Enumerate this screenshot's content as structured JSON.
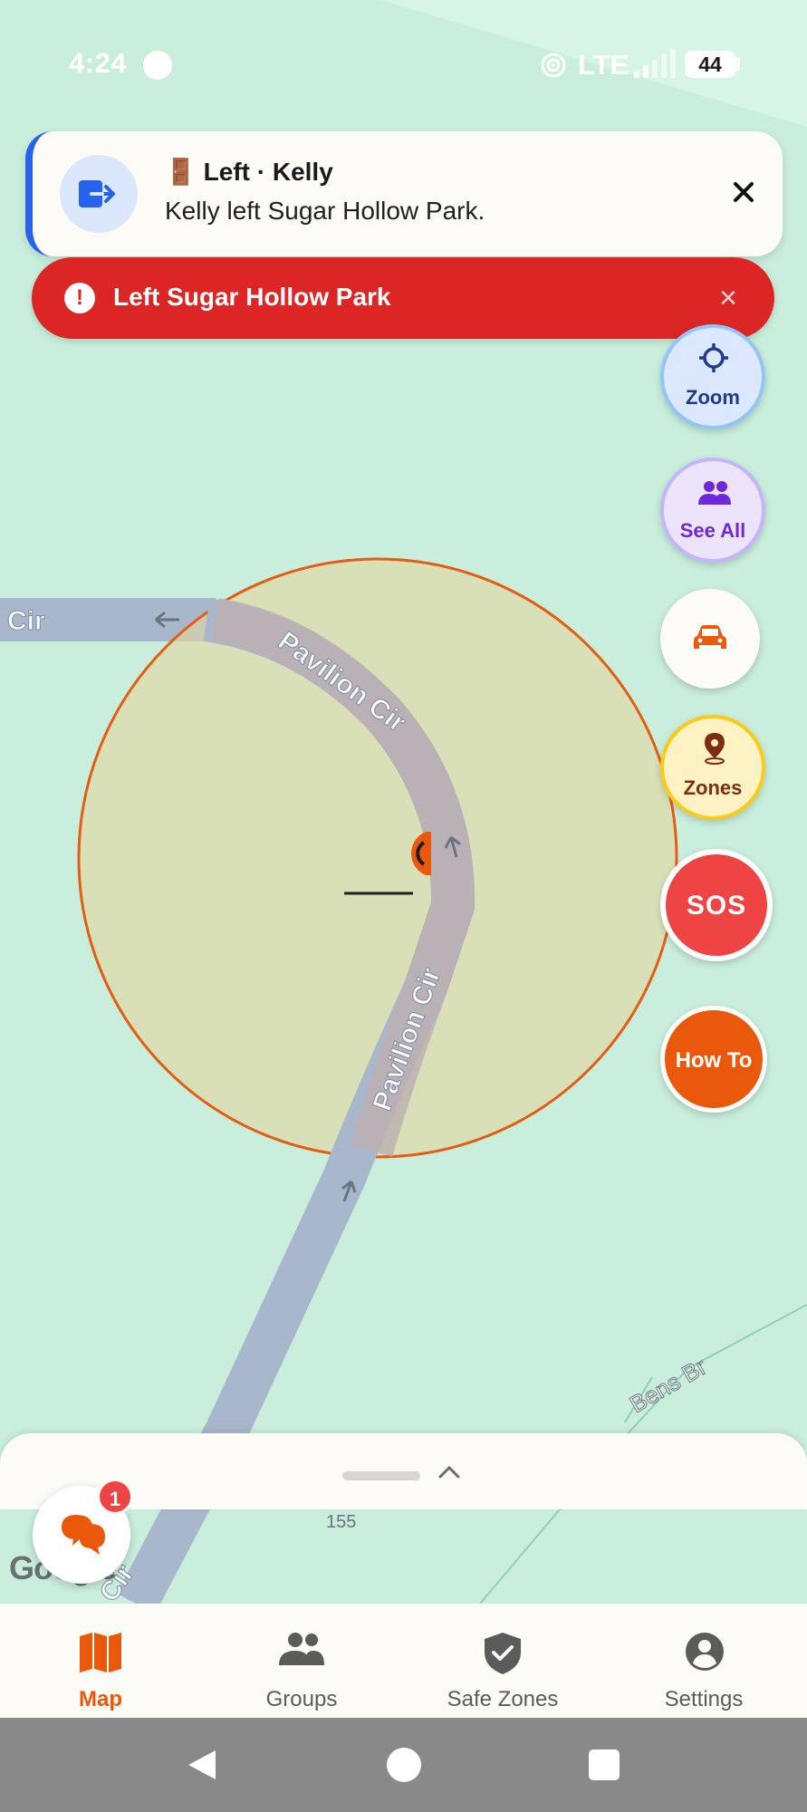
{
  "status_bar": {
    "time": "4:24",
    "network": "LTE",
    "battery": "44"
  },
  "map": {
    "street_labels": [
      "Cir",
      "Pavilion Cir",
      "Pavilion Cir",
      "Bens Br",
      "155",
      "Cir"
    ],
    "provider": "Google",
    "zone_color": "#e35d14"
  },
  "notification": {
    "icon": "exit-door-icon",
    "emoji": "🚪",
    "title": "Left · Kelly",
    "body": "Kelly left Sugar Hollow Park.",
    "accent": "#2563eb"
  },
  "alert": {
    "icon": "!",
    "text": "Left Sugar Hollow Park",
    "color": "#dc2626"
  },
  "side_buttons": {
    "zoom": "Zoom",
    "see_all": "See All",
    "zones": "Zones",
    "sos": "SOS",
    "how_to": "How To"
  },
  "chat": {
    "badge": "1"
  },
  "bottom_nav": {
    "items": [
      {
        "label": "Map",
        "icon": "map-icon",
        "active": true
      },
      {
        "label": "Groups",
        "icon": "groups-icon",
        "active": false
      },
      {
        "label": "Safe Zones",
        "icon": "shield-check-icon",
        "active": false
      },
      {
        "label": "Settings",
        "icon": "account-icon",
        "active": false
      }
    ],
    "active_color": "#ea580c"
  }
}
